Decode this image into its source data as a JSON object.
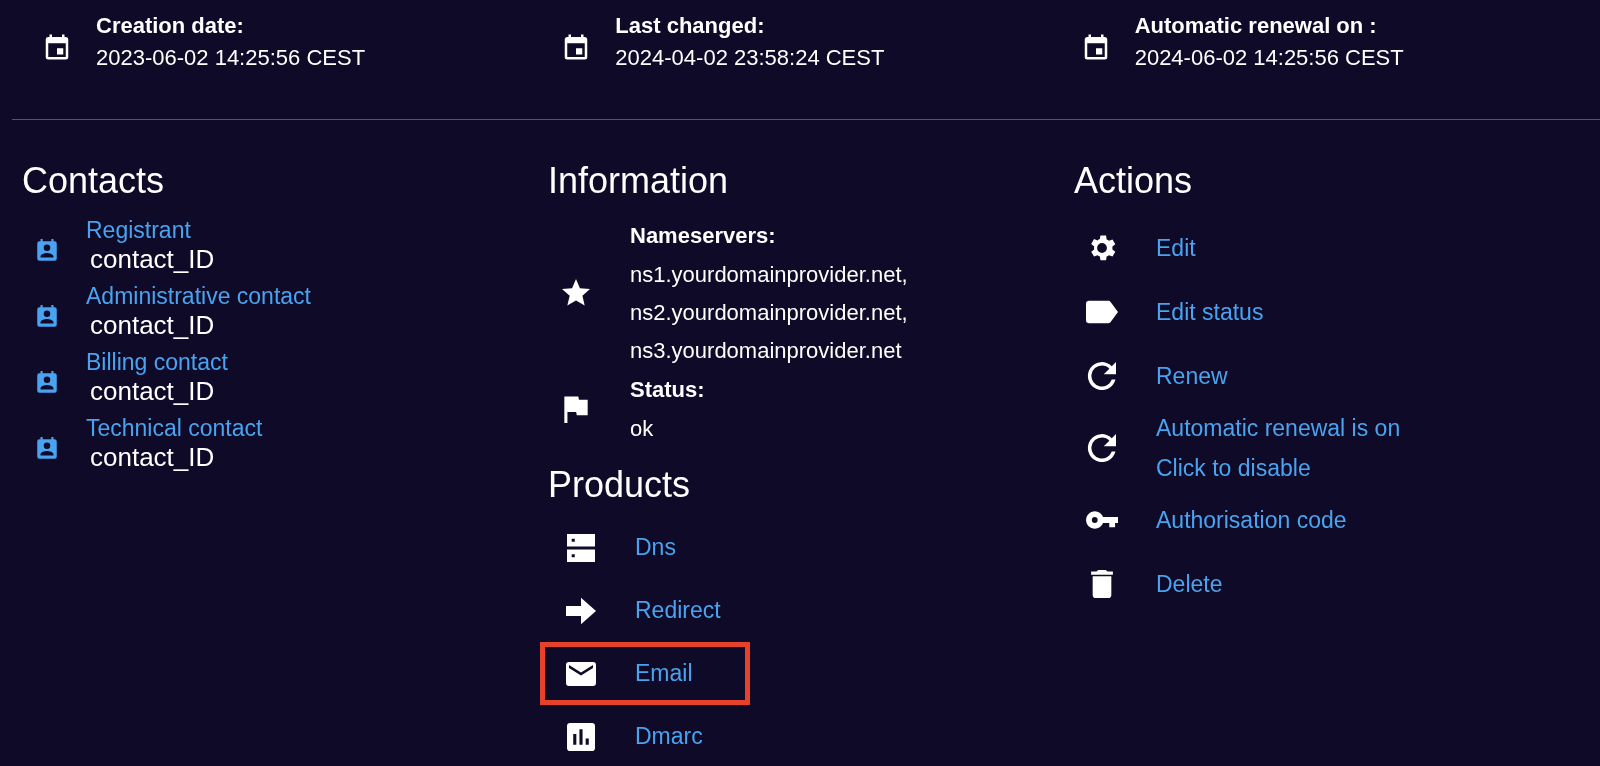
{
  "dates": [
    {
      "label": "Creation date:",
      "value": "2023-06-02 14:25:56 CEST"
    },
    {
      "label": "Last changed:",
      "value": "2024-04-02 23:58:24 CEST"
    },
    {
      "label": "Automatic renewal on :",
      "value": "2024-06-02 14:25:56 CEST"
    }
  ],
  "contacts": {
    "title": "Contacts",
    "items": [
      {
        "role": "Registrant",
        "id": "contact_ID"
      },
      {
        "role": "Administrative contact",
        "id": "contact_ID"
      },
      {
        "role": "Billing contact",
        "id": "contact_ID"
      },
      {
        "role": "Technical contact",
        "id": "contact_ID"
      }
    ]
  },
  "information": {
    "title": "Information",
    "items": [
      {
        "kind": "star",
        "label": "Nameservers:",
        "lines": [
          "ns1.yourdomainprovider.net,",
          "ns2.yourdomainprovider.net,",
          "ns3.yourdomainprovider.net"
        ]
      },
      {
        "kind": "flag",
        "label": "Status:",
        "lines": [
          "ok"
        ]
      }
    ]
  },
  "products": {
    "title": "Products",
    "items": [
      {
        "kind": "dns",
        "label": "Dns",
        "highlighted": false
      },
      {
        "kind": "redirect",
        "label": "Redirect",
        "highlighted": false
      },
      {
        "kind": "email",
        "label": "Email",
        "highlighted": true
      },
      {
        "kind": "chart",
        "label": "Dmarc",
        "highlighted": false
      }
    ]
  },
  "actions": {
    "title": "Actions",
    "items": [
      {
        "kind": "gear",
        "lines": [
          "Edit"
        ]
      },
      {
        "kind": "tag",
        "lines": [
          "Edit status"
        ]
      },
      {
        "kind": "refresh",
        "lines": [
          "Renew"
        ]
      },
      {
        "kind": "refresh",
        "lines": [
          "Automatic renewal is on",
          "Click to disable"
        ]
      },
      {
        "kind": "key",
        "lines": [
          "Authorisation code"
        ]
      },
      {
        "kind": "trash",
        "lines": [
          "Delete"
        ]
      }
    ]
  }
}
